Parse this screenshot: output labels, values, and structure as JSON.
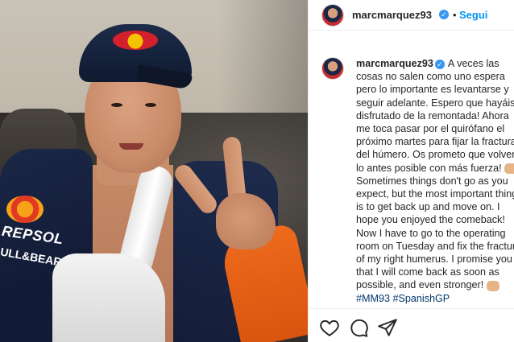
{
  "header": {
    "username": "marcmarquez93",
    "separator": "•",
    "follow_label": "Segui"
  },
  "post": {
    "username": "marcmarquez93",
    "caption_es": "A veces las cosas no salen como uno espera pero lo importante es levantarse y seguir adelante. Espero que hayáis disfrutado de la remontada! Ahora me toca pasar por el quirófano el próximo martes para fijar la fractura del húmero. Os prometo que volveré lo antes posible con más fuerza!",
    "caption_en": "Sometimes things don't go as you expect, but the most important thing is to get back up and move on. I hope you enjoyed the comeback! Now I have to go to the operating room on Tuesday and fix the fracture of my right humerus. I promise you all that I will come back as soon as possible, and even stronger!",
    "hashtags": "#MM93 #SpanishGP"
  },
  "photo": {
    "jacket_text_1": "REPSOL",
    "jacket_text_2": "ULL&BEAR"
  },
  "icons": {
    "like": "heart-icon",
    "comment": "comment-icon",
    "share": "share-icon",
    "verified": "verified-badge-icon"
  },
  "colors": {
    "follow": "#0095f6",
    "verified": "#3897f0",
    "hashtag": "#00376b"
  }
}
